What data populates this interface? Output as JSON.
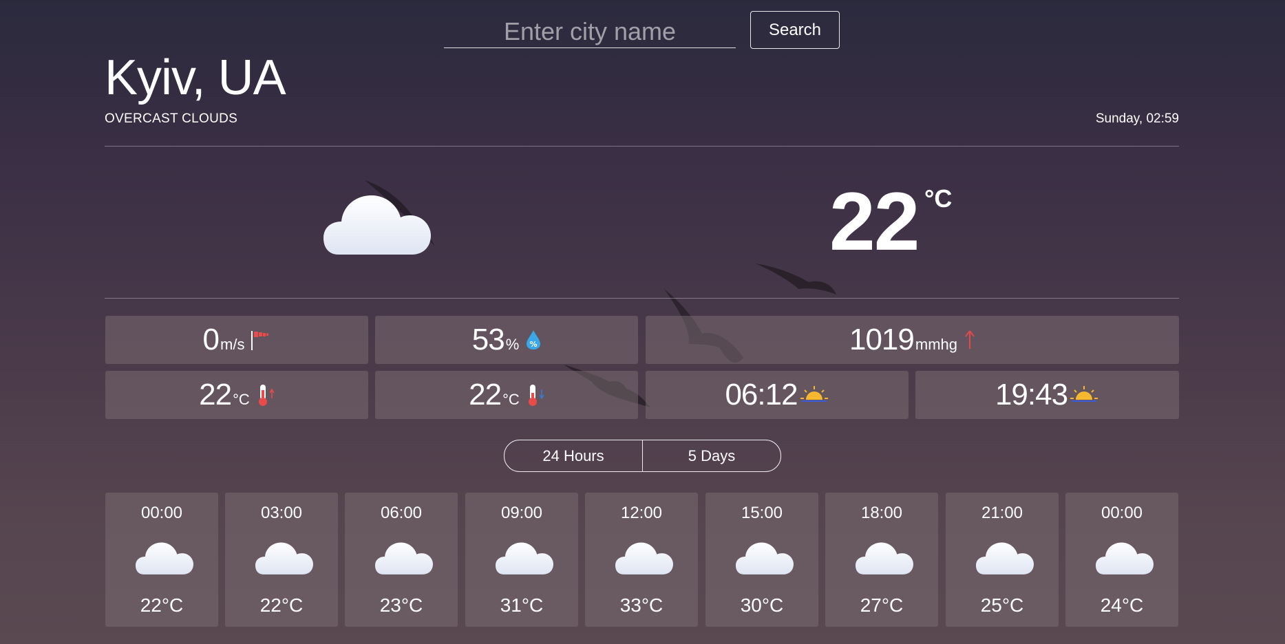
{
  "search": {
    "placeholder": "Enter city name",
    "button_label": "Search"
  },
  "location": {
    "city": "Kyiv, UA",
    "conditions": "OVERCAST CLOUDS",
    "datetime": "Sunday, 02:59"
  },
  "current": {
    "temperature": "22",
    "unit": "°C",
    "icon": "cloud-icon"
  },
  "metrics": {
    "wind": {
      "value": "0",
      "unit": "m/s",
      "icon": "windsock-icon"
    },
    "humidity": {
      "value": "53",
      "unit": "%",
      "icon": "humidity-drop-icon"
    },
    "pressure": {
      "value": "1019",
      "unit": "mmhg",
      "icon": "arrow-up-icon"
    },
    "temp_max": {
      "value": "22",
      "unit": "°C",
      "icon": "thermometer-up-icon"
    },
    "temp_min": {
      "value": "22",
      "unit": "°C",
      "icon": "thermometer-down-icon"
    },
    "sunrise": {
      "value": "06:12",
      "icon": "sunrise-icon"
    },
    "sunset": {
      "value": "19:43",
      "icon": "sunset-icon"
    }
  },
  "tabs": {
    "hours": "24 Hours",
    "days": "5 Days"
  },
  "forecast": [
    {
      "time": "00:00",
      "temp": "22°C",
      "icon": "cloud-icon"
    },
    {
      "time": "03:00",
      "temp": "22°C",
      "icon": "cloud-icon"
    },
    {
      "time": "06:00",
      "temp": "23°C",
      "icon": "cloud-icon"
    },
    {
      "time": "09:00",
      "temp": "31°C",
      "icon": "cloud-icon"
    },
    {
      "time": "12:00",
      "temp": "33°C",
      "icon": "cloud-icon"
    },
    {
      "time": "15:00",
      "temp": "30°C",
      "icon": "cloud-icon"
    },
    {
      "time": "18:00",
      "temp": "27°C",
      "icon": "cloud-icon"
    },
    {
      "time": "21:00",
      "temp": "25°C",
      "icon": "cloud-icon"
    },
    {
      "time": "00:00",
      "temp": "24°C",
      "icon": "cloud-icon"
    }
  ]
}
